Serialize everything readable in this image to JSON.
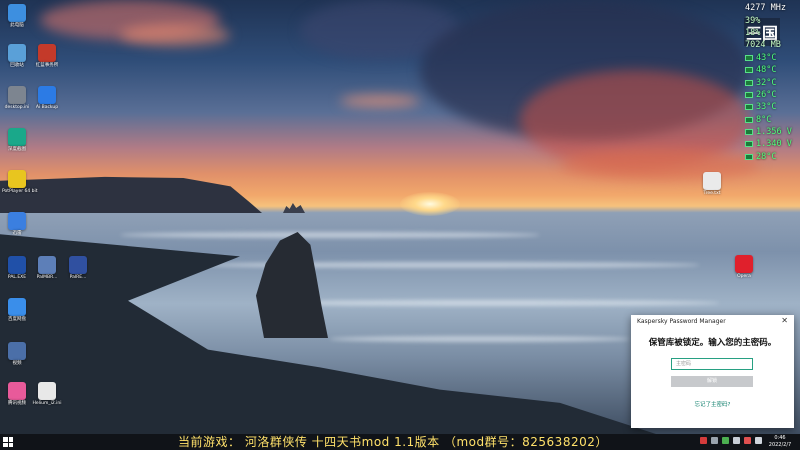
{
  "monitor": {
    "cpu_freq": "4277 MHz",
    "stat_2": "39%",
    "stat_3": "18%",
    "memory": "7024 MB",
    "temps": [
      "43°C",
      "48°C",
      "32°C",
      "26°C",
      "33°C",
      "8°C"
    ],
    "volts": [
      "1.356 V",
      "1.340 V"
    ],
    "last_temp": "28°C"
  },
  "desktop_icons": [
    {
      "label": "此电脑",
      "icon": "computer-icon",
      "color": "#3d8fe0"
    },
    {
      "label": "回收站",
      "icon": "recycle-bin-icon",
      "color": "#5aa0d8"
    },
    {
      "label": "红蓝事务所",
      "icon": "app-icon",
      "color": "#c43a2a"
    },
    {
      "label": "desktop.ini",
      "icon": "file-icon",
      "color": "#7d8590"
    },
    {
      "label": "Ai Backup",
      "icon": "backup-icon",
      "color": "#2c7be5"
    },
    {
      "label": "深度截图",
      "icon": "screenshot-icon",
      "color": "#1aa88a"
    },
    {
      "label": "PotPlayer 64 bit",
      "icon": "potplayer-icon",
      "color": "#e8c51f"
    },
    {
      "label": "迅雷",
      "icon": "thunder-icon",
      "color": "#3b7fe0"
    },
    {
      "label": "PAL.EXE",
      "icon": "pal-icon",
      "color": "#2050a8"
    },
    {
      "label": "PalMBR...",
      "icon": "pal-mbr-icon",
      "color": "#5d7fb8"
    },
    {
      "label": "PalRE...",
      "icon": "pal-re-icon",
      "color": "#3050a0"
    },
    {
      "label": "百度网盘",
      "icon": "baidu-netdisk-icon",
      "color": "#3a8eea"
    },
    {
      "label": "视频",
      "icon": "video-icon",
      "color": "#4b6fa8"
    },
    {
      "label": "腾讯视频",
      "icon": "tencent-video-icon",
      "color": "#e85a9a"
    },
    {
      "label": "Helium_i2.ini",
      "icon": "ini-file-icon",
      "color": "#e8e8e8"
    },
    {
      "label": "Tree.txt",
      "icon": "text-file-icon",
      "color": "#eaeaea"
    },
    {
      "label": "Opera",
      "icon": "opera-icon",
      "color": "#e0202c"
    }
  ],
  "dialog": {
    "title": "Kaspersky Password Manager",
    "heading": "保管库被锁定。输入您的主密码。",
    "password_placeholder": "主密码",
    "unlock_label": "解锁",
    "forgot_link": "忘记了主密码?"
  },
  "taskbar": {
    "banner": "当前游戏：  河洛群侠传  十四天书mod 1.1版本 （mod群号：825638202）",
    "time": "0:46",
    "date": "2022/2/7"
  }
}
